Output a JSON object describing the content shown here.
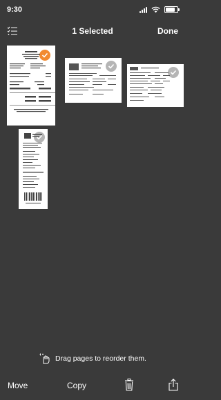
{
  "status": {
    "time": "9:30"
  },
  "nav": {
    "title": "1 Selected",
    "done_label": "Done"
  },
  "hint": {
    "text": "Drag pages to reorder them."
  },
  "toolbar": {
    "move_label": "Move",
    "copy_label": "Copy"
  },
  "colors": {
    "background": "#3a3a3a",
    "selected_accent": "#f28a2f",
    "unselected_check": "#a9a9a9"
  },
  "pages": [
    {
      "id": "page-1",
      "selected": true
    },
    {
      "id": "page-2",
      "selected": false
    },
    {
      "id": "page-3",
      "selected": false
    },
    {
      "id": "page-4",
      "selected": false
    }
  ]
}
